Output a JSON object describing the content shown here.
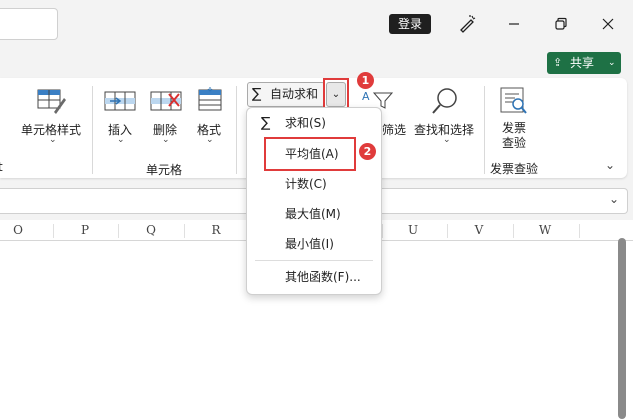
{
  "titlebar": {
    "login": "登录"
  },
  "share": {
    "label": "共享"
  },
  "ribbon": {
    "cell_style": "单元格样式",
    "insert": "插入",
    "delete": "删除",
    "format": "格式",
    "cells_group": "单元格",
    "autosum": "自动求和",
    "sort_filter": "筛选",
    "find_select": "查找和选择",
    "invoice_check_l1": "发票",
    "invoice_check_l2": "查验",
    "invoice_group": "发票查验",
    "left_cut": "t"
  },
  "columns": [
    "O",
    "P",
    "Q",
    "R",
    "U",
    "V",
    "W"
  ],
  "menu": {
    "items": [
      "求和(S)",
      "平均值(A)",
      "计数(C)",
      "最大值(M)",
      "最小值(I)",
      "其他函数(F)..."
    ]
  },
  "badges": [
    "1",
    "2"
  ],
  "colors": {
    "share_green": "#1e7145",
    "highlight_red": "#e03b3b"
  }
}
